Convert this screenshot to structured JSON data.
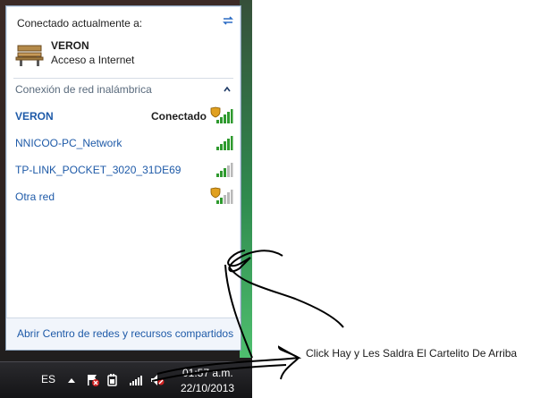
{
  "flyout": {
    "header_title": "Conectado actualmente a:",
    "current": {
      "name": "VERON",
      "status": "Acceso a Internet"
    },
    "section_title": "Conexión de red inalámbrica",
    "networks": [
      {
        "name": "VERON",
        "status": "Conectado",
        "secured": true,
        "signal_bars": 5,
        "selected": true
      },
      {
        "name": "NNICOO-PC_Network",
        "status": "",
        "secured": false,
        "signal_bars": 5
      },
      {
        "name": "TP-LINK_POCKET_3020_31DE69",
        "status": "",
        "secured": false,
        "signal_bars": 3
      },
      {
        "name": "Otra red",
        "status": "",
        "secured": true,
        "signal_bars": 2
      }
    ],
    "footer_link": "Abrir Centro de redes y recursos compartidos",
    "icons": {
      "refresh": "refresh-icon",
      "collapse": "chevron-up-icon",
      "current": "bench-icon"
    }
  },
  "taskbar": {
    "language": "ES",
    "time": "01:57 a.m.",
    "date": "22/10/2013",
    "icons": [
      "show-hidden-icons",
      "action-center-flag-icon",
      "power-icon",
      "network-signal-icon",
      "volume-muted-icon"
    ]
  },
  "annotation": {
    "note": "Click Hay  y Les Saldra El Cartelito De Arriba"
  },
  "colors": {
    "link": "#1e5aa8",
    "signal": "#2f9a2f",
    "signal_off": "#b9b9b9",
    "shield": "#e0a020"
  }
}
